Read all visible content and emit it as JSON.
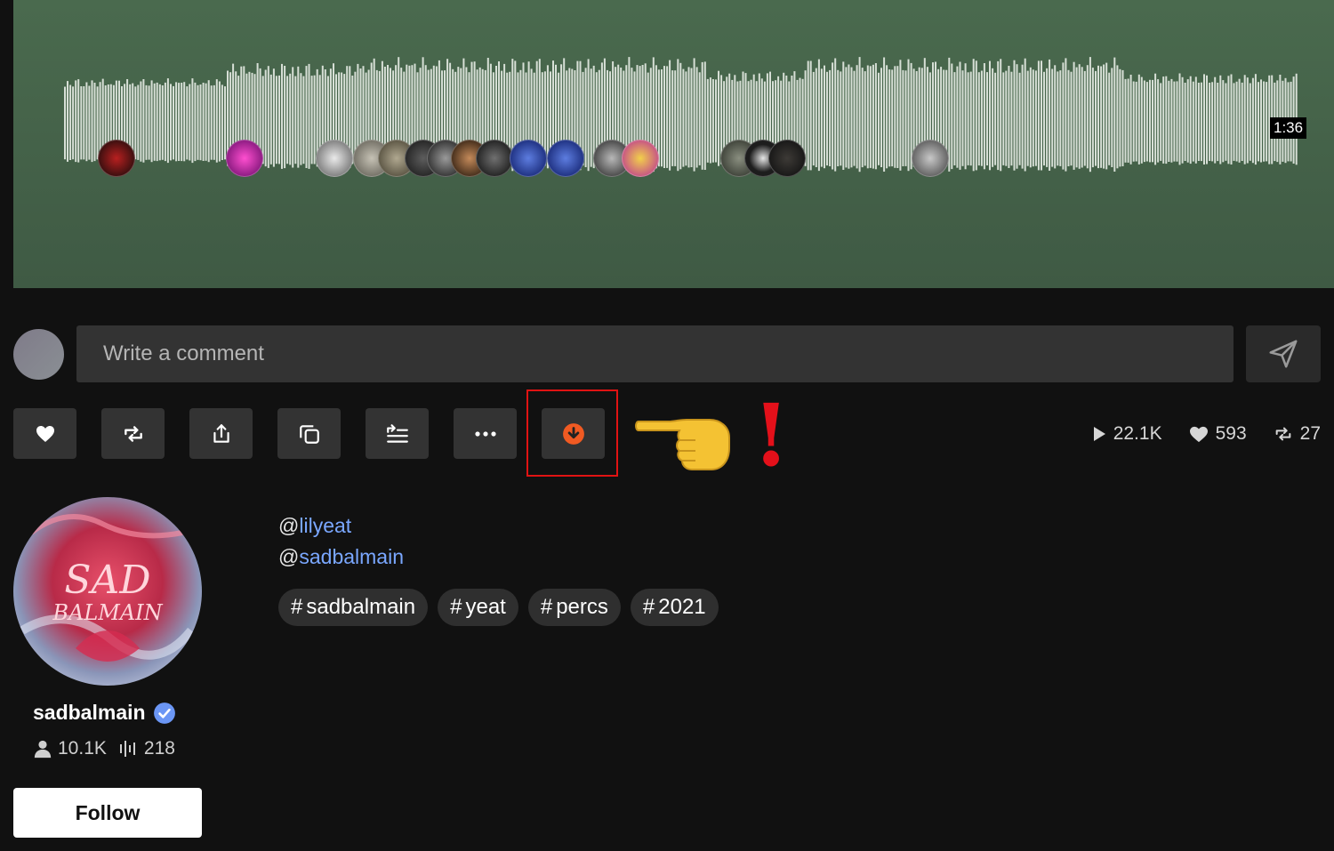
{
  "player": {
    "duration": "1:36"
  },
  "comment": {
    "placeholder": "Write a comment"
  },
  "actions": [
    {
      "name": "like-button",
      "icon": "heart-icon"
    },
    {
      "name": "repost-button",
      "icon": "repost-icon"
    },
    {
      "name": "share-button",
      "icon": "share-icon"
    },
    {
      "name": "copy-link-button",
      "icon": "copy-icon"
    },
    {
      "name": "add-to-queue-button",
      "icon": "queue-icon"
    },
    {
      "name": "more-button",
      "icon": "ellipsis-icon"
    },
    {
      "name": "download-button",
      "icon": "download-icon",
      "accent": "#f05a22"
    }
  ],
  "stats": {
    "plays": "22.1K",
    "likes": "593",
    "reposts": "27"
  },
  "artist": {
    "username": "sadbalmain",
    "followers": "10.1K",
    "tracks": "218",
    "follow_label": "Follow"
  },
  "mentions": [
    {
      "at": "@",
      "handle": "lilyeat"
    },
    {
      "at": "@",
      "handle": "sadbalmain"
    }
  ],
  "tags": [
    {
      "hash": "#",
      "label": "sadbalmain"
    },
    {
      "hash": "#",
      "label": "yeat"
    },
    {
      "hash": "#",
      "label": "percs"
    },
    {
      "hash": "#",
      "label": "2021"
    }
  ],
  "annotation": {
    "exclamation": "!"
  },
  "colors": {
    "background": "#111111",
    "waveform_bg": "#466349",
    "link": "#7aa7ff",
    "highlight": "#e01313"
  }
}
